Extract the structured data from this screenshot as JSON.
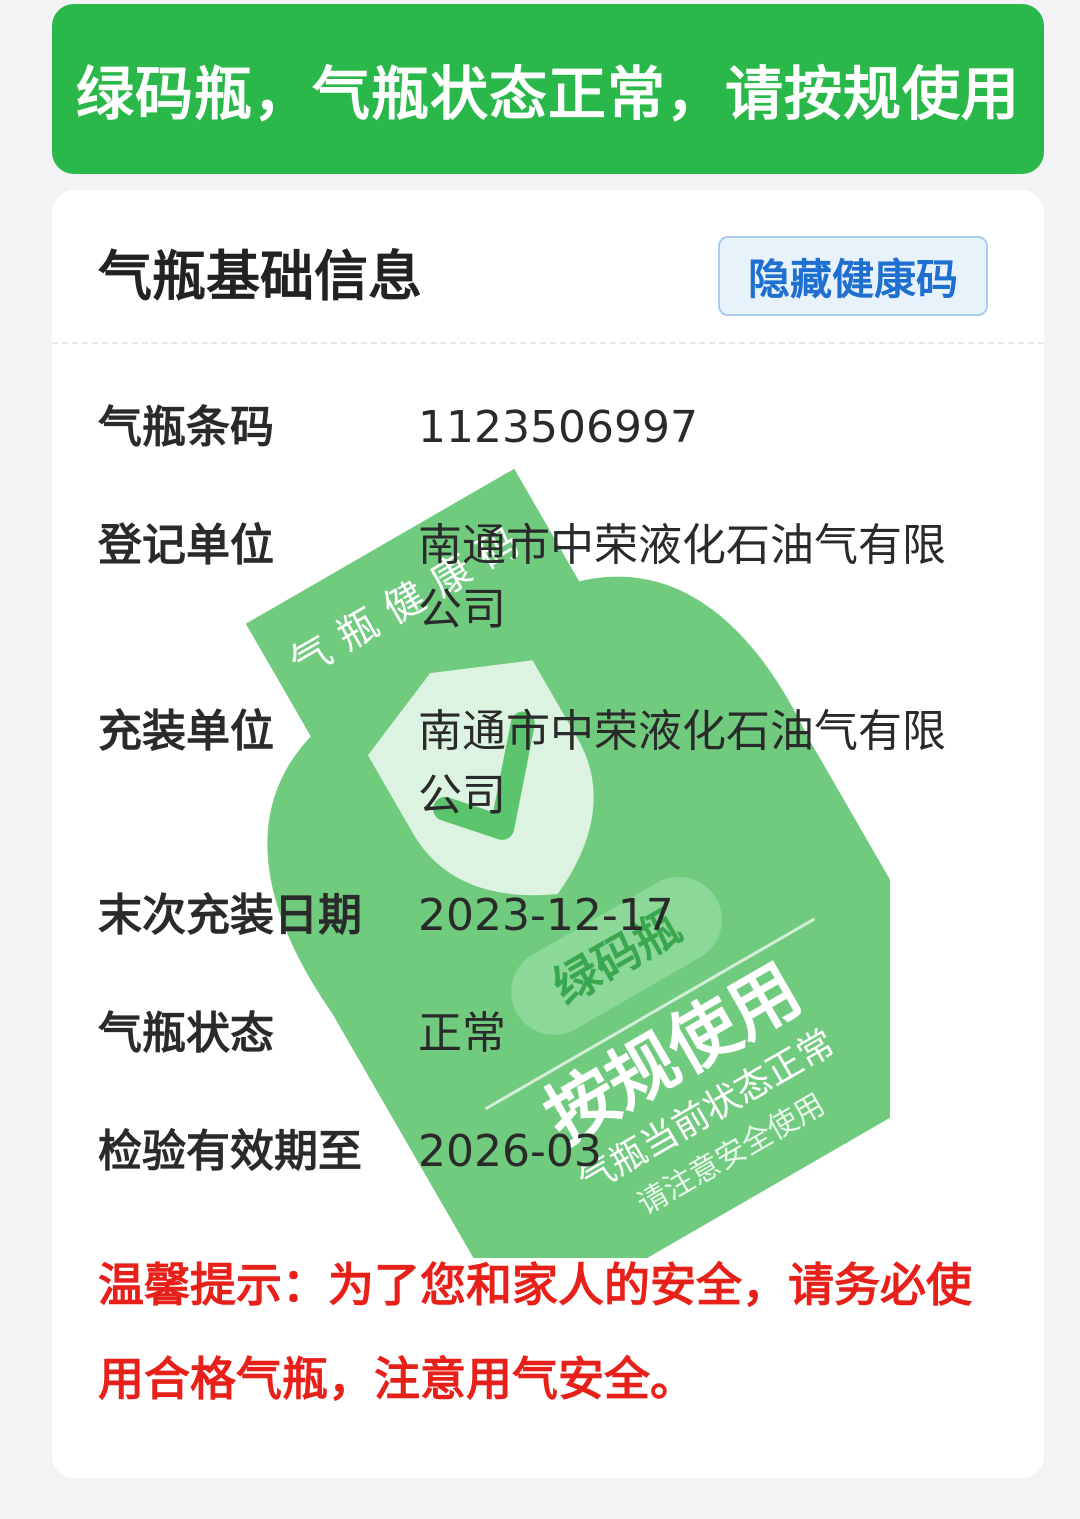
{
  "banner": {
    "text": "绿码瓶，气瓶状态正常，请按规使用",
    "color": "#2bb84a"
  },
  "card": {
    "title": "气瓶基础信息",
    "hide_button_label": "隐藏健康码"
  },
  "info_rows": [
    {
      "label": "气瓶条码",
      "value": "1123506997"
    },
    {
      "label": "登记单位",
      "value": "南通市中荣液化石油气有限公司"
    },
    {
      "label": "充装单位",
      "value": "南通市中荣液化石油气有限公司"
    },
    {
      "label": "末次充装日期",
      "value": "2023-12-17"
    },
    {
      "label": "气瓶状态",
      "value": "正常"
    },
    {
      "label": "检验有效期至",
      "value": "2026-03"
    }
  ],
  "tip": {
    "text": "温馨提示：为了您和家人的安全，请务必使用合格气瓶，注意用气安全。",
    "color": "#e8201a"
  },
  "watermark": {
    "top_label": "气瓶健康码",
    "badge": "绿码瓶",
    "main": "按规使用",
    "line1": "气瓶当前状态正常",
    "line2": "请注意安全使用",
    "icon": "shield-check-icon",
    "color": "#5cc46d"
  }
}
